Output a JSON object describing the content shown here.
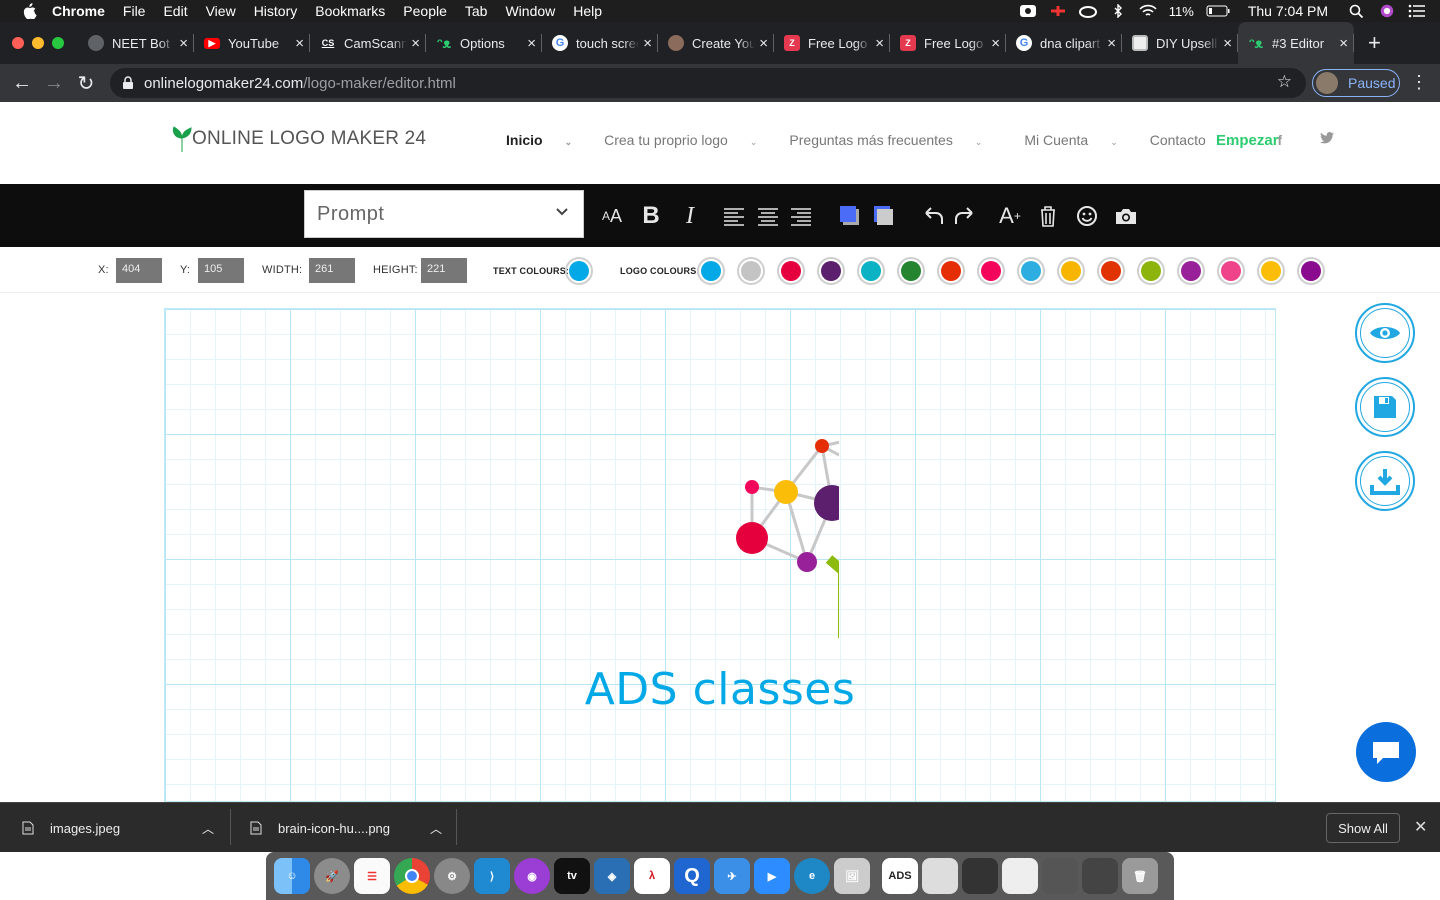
{
  "mac": {
    "app": "Chrome",
    "menu": [
      "File",
      "Edit",
      "View",
      "History",
      "Bookmarks",
      "People",
      "Tab",
      "Window",
      "Help"
    ],
    "battery": "11%",
    "clock": "Thu 7:04 PM"
  },
  "tabs": [
    {
      "label": "NEET Bot",
      "icon": "globe-icon"
    },
    {
      "label": "YouTube",
      "icon": "youtube-icon"
    },
    {
      "label": "CamScanner",
      "icon": "camscanner-icon"
    },
    {
      "label": "Options",
      "icon": "extension-icon"
    },
    {
      "label": "touch screen",
      "icon": "google-icon"
    },
    {
      "label": "Create Your",
      "icon": "brush-icon"
    },
    {
      "label": "Free Logo",
      "icon": "zyro-icon"
    },
    {
      "label": "Free Logo",
      "icon": "zyro-icon"
    },
    {
      "label": "dna clipart",
      "icon": "google-icon"
    },
    {
      "label": "DIY Upsell",
      "icon": "grid-icon"
    },
    {
      "label": "#3 Editor",
      "icon": "extension-icon"
    }
  ],
  "address": {
    "host": "onlinelogomaker24.com",
    "path": "/logo-maker/editor.html",
    "profile_status": "Paused"
  },
  "site": {
    "brand": "ONLINE LOGO MAKER 24",
    "nav": [
      "Inicio",
      "Crea tu proprio logo",
      "Preguntas más frecuentes",
      "Mi Cuenta",
      "Contacto"
    ],
    "cta": "Empezar"
  },
  "editor": {
    "font_select": "Prompt",
    "props": {
      "x_label": "X:",
      "x": "404",
      "y_label": "Y:",
      "y": "105",
      "width_label": "WIDTH:",
      "width": "261",
      "height_label": "HEIGHT:",
      "height": "221",
      "text_colours_label": "TEXT COLOURS:",
      "logo_colours_label": "LOGO COLOURS:"
    },
    "text_colour": "#03a9e6",
    "logo_colours": [
      "#03a9e6",
      "#c4c4c4",
      "#e5003d",
      "#5b1f6d",
      "#0ab2c4",
      "#25842f",
      "#e52e06",
      "#f3055c",
      "#2eaee0",
      "#f7b500",
      "#e03202",
      "#8cb40d",
      "#982099",
      "#f0448a",
      "#fbbd08",
      "#8a0b8e"
    ],
    "logo_text": "ADS classes"
  },
  "downloads": {
    "items": [
      "images.jpeg",
      "brain-icon-hu....png"
    ],
    "show_all": "Show All"
  }
}
